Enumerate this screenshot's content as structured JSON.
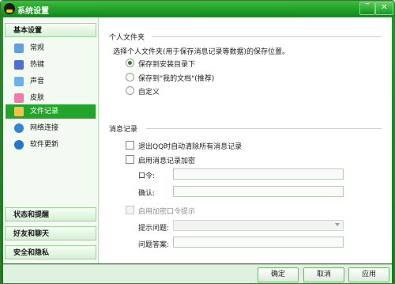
{
  "window": {
    "title": "系统设置",
    "controls": {
      "minimize": "‾",
      "close": "✕"
    }
  },
  "sidebar": {
    "basic_header": "基本设置",
    "items": [
      {
        "label": "常规",
        "icon": "general-icon",
        "selected": false
      },
      {
        "label": "热键",
        "icon": "hotkey-icon",
        "selected": false
      },
      {
        "label": "声音",
        "icon": "sound-icon",
        "selected": false
      },
      {
        "label": "皮肤",
        "icon": "skin-icon",
        "selected": false
      },
      {
        "label": "文件记录",
        "icon": "folder-icon",
        "selected": true
      },
      {
        "label": "网络连接",
        "icon": "network-icon",
        "selected": false
      },
      {
        "label": "软件更新",
        "icon": "update-icon",
        "selected": false
      }
    ],
    "collapsed_sections": [
      "状态和提醒",
      "好友和聊天",
      "安全和隐私"
    ]
  },
  "personal_folder": {
    "title": "个人文件夹",
    "description": "选择个人文件夹(用于保存消息记录等数据)的保存位置。",
    "options": [
      {
        "label": "保存到安装目录下",
        "checked": true
      },
      {
        "label": "保存到\"我的文档\"(推荐)",
        "checked": false
      },
      {
        "label": "自定义",
        "checked": false
      }
    ]
  },
  "message_record": {
    "title": "消息记录",
    "clear_on_exit": "退出QQ时自动清除所有消息记录",
    "enable_encrypt": "启用消息记录加密",
    "password_label": "口令:",
    "confirm_label": "确认:",
    "enable_hint": "启用加密口令提示",
    "hint_question_label": "提示问题:",
    "hint_answer_label": "问题答案:"
  },
  "buttons": {
    "ok": "确定",
    "cancel": "取消",
    "apply": "应用"
  },
  "colors": {
    "accent": "#23a52b",
    "title_green": "#0f8a1c"
  }
}
